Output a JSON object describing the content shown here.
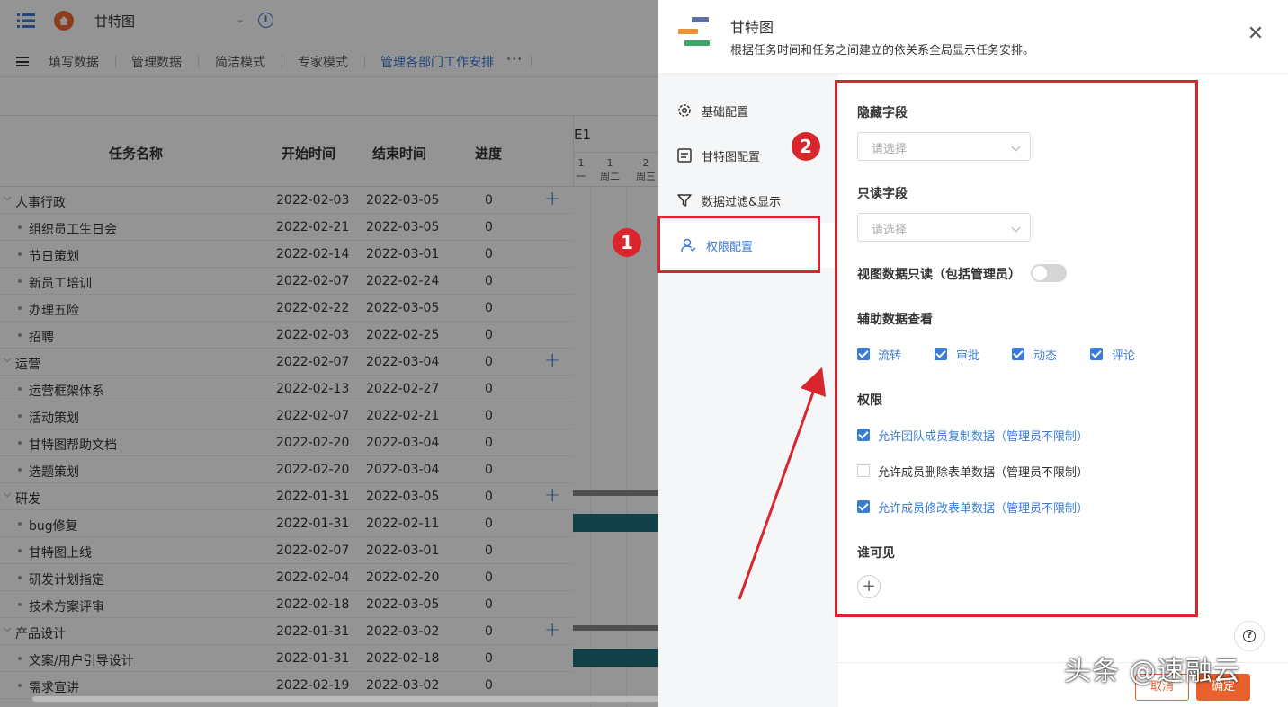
{
  "app": {
    "title": "甘特图"
  },
  "views": {
    "tabs": [
      "填写数据",
      "管理数据",
      "简洁模式",
      "专家模式",
      "管理各部门工作安排"
    ],
    "active_index": 4,
    "more": "···"
  },
  "grid": {
    "headers": {
      "name": "任务名称",
      "start": "开始时间",
      "end": "结束时间",
      "progress": "进度"
    },
    "rows": [
      {
        "name": "人事行政",
        "start": "2022-02-03",
        "end": "2022-03-05",
        "progress": "0",
        "group": true
      },
      {
        "name": "组织员工生日会",
        "start": "2022-02-21",
        "end": "2022-03-05",
        "progress": "0",
        "group": false
      },
      {
        "name": "节日策划",
        "start": "2022-02-14",
        "end": "2022-03-01",
        "progress": "0",
        "group": false
      },
      {
        "name": "新员工培训",
        "start": "2022-02-07",
        "end": "2022-02-24",
        "progress": "0",
        "group": false
      },
      {
        "name": "办理五险",
        "start": "2022-02-22",
        "end": "2022-03-05",
        "progress": "0",
        "group": false
      },
      {
        "name": "招聘",
        "start": "2022-02-03",
        "end": "2022-02-25",
        "progress": "0",
        "group": false
      },
      {
        "name": "运营",
        "start": "2022-02-07",
        "end": "2022-03-04",
        "progress": "0",
        "group": true
      },
      {
        "name": "运营框架体系",
        "start": "2022-02-13",
        "end": "2022-02-27",
        "progress": "0",
        "group": false
      },
      {
        "name": "活动策划",
        "start": "2022-02-07",
        "end": "2022-02-21",
        "progress": "0",
        "group": false
      },
      {
        "name": "甘特图帮助文档",
        "start": "2022-02-20",
        "end": "2022-03-04",
        "progress": "0",
        "group": false
      },
      {
        "name": "选题策划",
        "start": "2022-02-20",
        "end": "2022-03-04",
        "progress": "0",
        "group": false
      },
      {
        "name": "研发",
        "start": "2022-01-31",
        "end": "2022-03-05",
        "progress": "0",
        "group": true
      },
      {
        "name": "bug修复",
        "start": "2022-01-31",
        "end": "2022-02-11",
        "progress": "0",
        "group": false
      },
      {
        "name": "甘特图上线",
        "start": "2022-02-07",
        "end": "2022-03-01",
        "progress": "0",
        "group": false
      },
      {
        "name": "研发计划指定",
        "start": "2022-02-04",
        "end": "2022-02-20",
        "progress": "0",
        "group": false
      },
      {
        "name": "技术方案评审",
        "start": "2022-02-18",
        "end": "2022-03-05",
        "progress": "0",
        "group": false
      },
      {
        "name": "产品设计",
        "start": "2022-01-31",
        "end": "2022-03-02",
        "progress": "0",
        "group": true
      },
      {
        "name": "文案/用户引导设计",
        "start": "2022-01-31",
        "end": "2022-02-18",
        "progress": "0",
        "group": false
      },
      {
        "name": "需求宣讲",
        "start": "2022-02-19",
        "end": "2022-03-02",
        "progress": "0",
        "group": false
      }
    ],
    "gantt_header": {
      "month": "E1",
      "days": [
        {
          "num": "1",
          "weekday": "一"
        },
        {
          "num": "1",
          "weekday": "周二"
        },
        {
          "num": "2",
          "weekday": "周三"
        }
      ]
    }
  },
  "drawer": {
    "title": "甘特图",
    "description": "根据任务时间和任务之间建立的依关系全局显示任务安排。",
    "nav": [
      {
        "label": "基础配置",
        "icon": "settings-gear-icon"
      },
      {
        "label": "甘特图配置",
        "icon": "document-list-icon"
      },
      {
        "label": "数据过滤&显示",
        "icon": "filter-icon"
      },
      {
        "label": "权限配置",
        "icon": "user-permission-icon"
      }
    ],
    "nav_active_index": 3,
    "fields": {
      "hidden_label": "隐藏字段",
      "hidden_placeholder": "请选择",
      "readonly_label": "只读字段",
      "readonly_placeholder": "请选择",
      "view_readonly_label": "视图数据只读（包括管理员）",
      "view_readonly_on": false,
      "aux_label": "辅助数据查看",
      "aux_options": [
        {
          "label": "流转",
          "checked": true
        },
        {
          "label": "审批",
          "checked": true
        },
        {
          "label": "动态",
          "checked": true
        },
        {
          "label": "评论",
          "checked": true
        }
      ],
      "perm_label": "权限",
      "perm_options": [
        {
          "label": "允许团队成员复制数据（管理员不限制）",
          "checked": true
        },
        {
          "label": "允许成员删除表单数据（管理员不限制）",
          "checked": false
        },
        {
          "label": "允许成员修改表单数据（管理员不限制）",
          "checked": true
        }
      ],
      "visible_label": "谁可见",
      "add_symbol": "+"
    },
    "footer": {
      "cancel": "取消",
      "ok": "确定"
    },
    "help_symbol": "?"
  },
  "annotations": {
    "badge1": "1",
    "badge2": "2"
  },
  "watermark": "头条 @速融云",
  "colors": {
    "accent": "#3a7bd5",
    "brand_orange": "#e8602c",
    "annotation_red": "#d9262c",
    "gantt_bar_teal": "#1e6e79",
    "logo_blue": "#5b6fa6",
    "logo_orange": "#e8933a",
    "logo_green": "#3fa66a"
  }
}
